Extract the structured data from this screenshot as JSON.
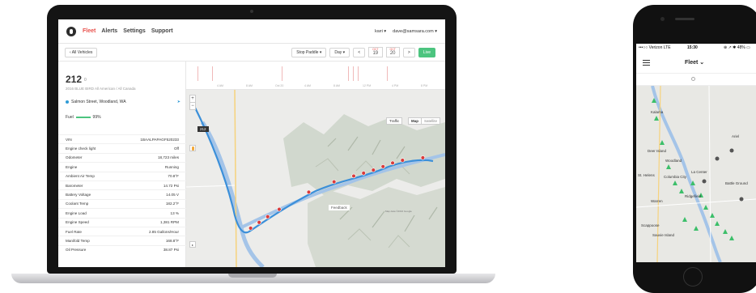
{
  "nav": {
    "brand": "Fleet",
    "items": [
      "Alerts",
      "Settings",
      "Support"
    ],
    "org": "kwri",
    "user": "dave@samsara.com"
  },
  "toolbar": {
    "back_label": "All Vehicles",
    "stop_paddle_label": "Stop Paddle",
    "day_label": "Day",
    "prev_arrow": "<",
    "next_arrow": ">",
    "date_a_month": "OCT",
    "date_a_day": "19",
    "date_b_month": "OCT",
    "date_b_day": "20",
    "live_label": "Live"
  },
  "vehicle": {
    "id": "212",
    "id_suffix": "0",
    "description": "2016 BLUE BIRD All American / All Canada",
    "location": "Salmon Street, Woodland, WA",
    "fuel_label": "Fuel",
    "fuel_value": "99%",
    "fuel_level": 0.99
  },
  "stats": [
    {
      "k": "VIN",
      "v": "1BAALPAPAGF520233"
    },
    {
      "k": "Engine check light",
      "v": "Off"
    },
    {
      "k": "Odometer",
      "v": "18,723 miles"
    },
    {
      "k": "Engine",
      "v": "Running"
    },
    {
      "k": "Ambient Air Temp",
      "v": "70.8°F"
    },
    {
      "k": "Barometer",
      "v": "14.72 Psi"
    },
    {
      "k": "Battery Voltage",
      "v": "14.05 V"
    },
    {
      "k": "Coolant Temp",
      "v": "182.2°F"
    },
    {
      "k": "Engine Load",
      "v": "13 %"
    },
    {
      "k": "Engine Speed",
      "v": "1,381 RPM"
    },
    {
      "k": "Fuel Rate",
      "v": "2.85 Gallons/Hour"
    },
    {
      "k": "Manifold Temp",
      "v": "168.8°F"
    },
    {
      "k": "Oil Pressure",
      "v": "38.87 Psi"
    }
  ],
  "timeline": {
    "labels": [
      "4 AM",
      "8 AM",
      "Oct 20",
      "4 AM",
      "8 AM",
      "12 PM",
      "4 PM",
      "8 PM"
    ]
  },
  "map": {
    "zoom_in": "+",
    "zoom_out": "−",
    "traffic_label": "Traffic",
    "map_label": "Map",
    "satellite_label": "Satellite",
    "tooltip": "212",
    "feedback": "Feedback",
    "credit": "Map data ©2016 Google",
    "route_color": "#3b8fd9",
    "stop_color": "#d93b3b",
    "river_color": "#a4c4e8"
  },
  "phone": {
    "carrier": "•••○○ Verizon  LTE",
    "time": "15:30",
    "status_right": "⊕ ↗ ✱ 48% ▭",
    "title": "Fleet",
    "map_labels": [
      "Kalama",
      "Deer Island",
      "Woodland",
      "Columbia City",
      "St. Helens",
      "La Center",
      "Ridgefield",
      "Warren",
      "Scappoose",
      "Sauvie Island",
      "Ariel",
      "Battle Ground"
    ],
    "marker_color": "#3cbf6a"
  }
}
